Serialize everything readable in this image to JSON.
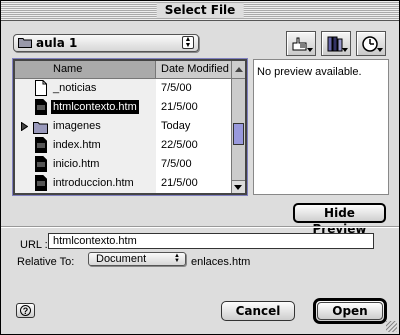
{
  "window": {
    "title": "Select File"
  },
  "folder_popup": {
    "label": "aula 1"
  },
  "toolbar": {
    "buttons": [
      {
        "name": "desktop-shortcut-button",
        "icon": "pointing-hand-icon"
      },
      {
        "name": "favorites-button",
        "icon": "books-icon"
      },
      {
        "name": "recent-button",
        "icon": "clock-icon"
      }
    ]
  },
  "filelist": {
    "headers": {
      "name": "Name",
      "date": "Date Modified"
    },
    "rows": [
      {
        "name": "_noticias",
        "date": "7/5/00",
        "icon": "document-icon",
        "selected": false,
        "folder": false
      },
      {
        "name": "htmlcontexto.htm",
        "date": "21/5/00",
        "icon": "html-file-icon",
        "selected": true,
        "folder": false
      },
      {
        "name": "imagenes",
        "date": "Today",
        "icon": "folder-icon",
        "selected": false,
        "folder": true
      },
      {
        "name": "index.htm",
        "date": "22/5/00",
        "icon": "html-file-icon",
        "selected": false,
        "folder": false
      },
      {
        "name": "inicio.htm",
        "date": "7/5/00",
        "icon": "html-file-icon",
        "selected": false,
        "folder": false
      },
      {
        "name": "introduccion.htm",
        "date": "21/5/00",
        "icon": "html-file-icon",
        "selected": false,
        "folder": false
      }
    ]
  },
  "preview": {
    "message": "No preview available.",
    "hide_label": "Hide Preview"
  },
  "url": {
    "label": "URL :",
    "value": "htmlcontexto.htm"
  },
  "relative": {
    "label": "Relative To:",
    "selected": "Document",
    "file": "enlaces.htm"
  },
  "buttons": {
    "help": "?",
    "cancel": "Cancel",
    "open": "Open"
  },
  "colors": {
    "accent": "#9999dd",
    "selection": "#000000",
    "background": "#dddddd"
  }
}
